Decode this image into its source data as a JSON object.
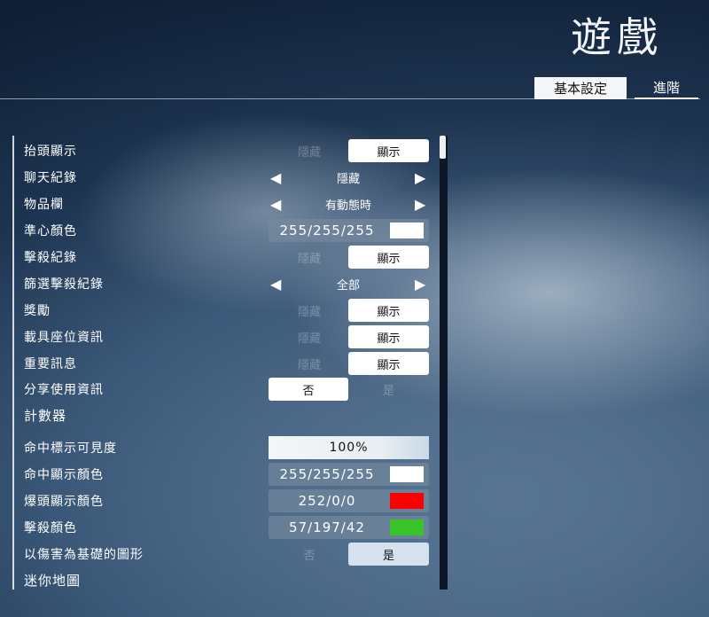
{
  "header": {
    "title": "遊戲",
    "tabs": [
      {
        "label": "基本設定",
        "active": true
      },
      {
        "label": "進階",
        "active": false
      }
    ]
  },
  "settings": {
    "hud": {
      "label": "抬頭顯示",
      "off": "隱藏",
      "on": "顯示"
    },
    "chat": {
      "label": "聊天紀錄",
      "value": "隱藏"
    },
    "inventory": {
      "label": "物品欄",
      "value": "有動態時"
    },
    "crosshair": {
      "label": "準心顏色",
      "value": "255/255/255",
      "color": "#ffffff"
    },
    "killfeed": {
      "label": "擊殺紀錄",
      "off": "隱藏",
      "on": "顯示"
    },
    "killfeed_filter": {
      "label": "篩選擊殺紀錄",
      "value": "全部"
    },
    "rewards": {
      "label": "獎勵",
      "off": "隱藏",
      "on": "顯示"
    },
    "vehicle_seat": {
      "label": "載具座位資訊",
      "off": "隱藏",
      "on": "顯示"
    },
    "important_msg": {
      "label": "重要訊息",
      "off": "隱藏",
      "on": "顯示"
    },
    "share_usage": {
      "label": "分享使用資訊",
      "no": "否",
      "yes": "是",
      "selected": "否"
    },
    "counter_section": {
      "label": "計數器"
    },
    "hit_marker_visibility": {
      "label": "命中標示可見度",
      "value": "100%"
    },
    "hit_color": {
      "label": "命中顯示顏色",
      "value": "255/255/255",
      "color": "#ffffff"
    },
    "headshot_color": {
      "label": "爆頭顯示顏色",
      "value": "252/0/0",
      "color": "#fc0000"
    },
    "kill_color": {
      "label": "擊殺顏色",
      "value": "57/197/42",
      "color": "#39c52a"
    },
    "damage_shape": {
      "label": "以傷害為基礎的圖形",
      "no": "否",
      "yes": "是",
      "selected": "是"
    },
    "minimap_section": {
      "label": "迷你地圖"
    }
  },
  "icons": {
    "arrow_left": "◀",
    "arrow_right": "▶"
  }
}
